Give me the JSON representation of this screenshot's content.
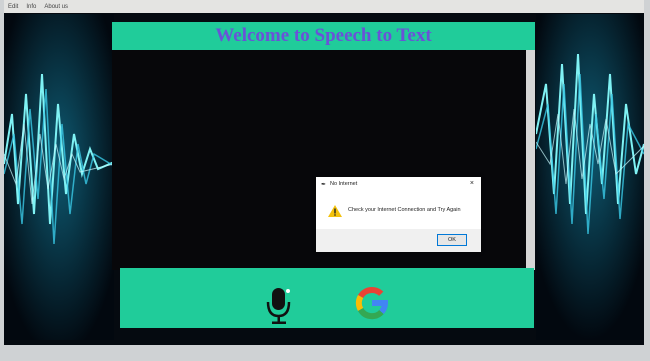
{
  "menu": [
    "Edit",
    "Info",
    "About us"
  ],
  "app": {
    "title": "Welcome to Speech to Text"
  },
  "dialog": {
    "title": "No Internet",
    "close_label": "×",
    "message": "Check your Internet Connection and Try Again",
    "ok_label": "OK"
  },
  "colors": {
    "accent": "#20cc9a",
    "title_text": "#6a52d8",
    "content_bg": "#07070a"
  },
  "icons": [
    "feather-icon",
    "close-icon",
    "warning-icon",
    "microphone-icon",
    "google-icon"
  ]
}
